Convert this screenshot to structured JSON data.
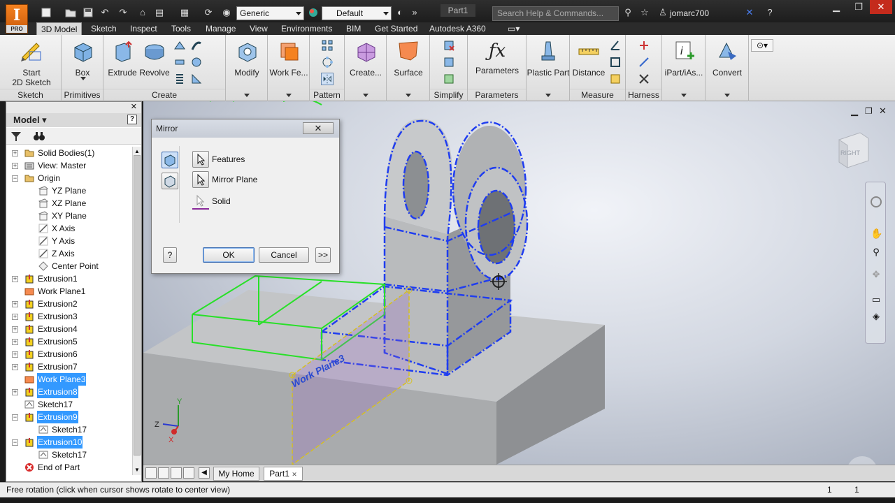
{
  "app": {
    "logo_letter": "I",
    "logo_tag": "PRO",
    "document_title": "Part1",
    "material_combo": "Generic",
    "appearance_combo": "Default",
    "help_search_placeholder": "Search Help & Commands...",
    "user_name": "jomarc700",
    "more_glyph": "»"
  },
  "ribbon_tabs": [
    "3D Model",
    "Sketch",
    "Inspect",
    "Tools",
    "Manage",
    "View",
    "Environments",
    "BIM",
    "Get Started",
    "Autodesk A360"
  ],
  "ribbon": {
    "sketch_panel": {
      "title": "Sketch",
      "start_line1": "Start",
      "start_line2": "2D Sketch"
    },
    "primitives_panel": {
      "title": "Primitives",
      "box": "Box"
    },
    "create_panel": {
      "title": "Create",
      "extrude": "Extrude",
      "revolve": "Revolve"
    },
    "modify_panel": {
      "modify": "Modify"
    },
    "workfeatures_panel": {
      "work_features": "Work Fe..."
    },
    "pattern_panel": {
      "title": "Pattern"
    },
    "create_freeform": {
      "create": "Create..."
    },
    "surface_panel": {
      "surface": "Surface"
    },
    "simplify_panel": {
      "title": "Simplify"
    },
    "parameters_panel": {
      "title": "Parameters",
      "parameters": "Parameters"
    },
    "plastic_panel": {
      "plastic_part": "Plastic Part"
    },
    "measure_panel": {
      "title": "Measure",
      "distance": "Distance"
    },
    "harness_panel": {
      "title": "Harness"
    },
    "ipart_panel": {
      "ipart": "iPart/iAs..."
    },
    "convert_panel": {
      "convert": "Convert"
    }
  },
  "browser": {
    "title": "Model",
    "items": [
      {
        "label": "Solid Bodies(1)",
        "icon": "folder-icon",
        "selected": false
      },
      {
        "label": "View: Master",
        "icon": "view-icon",
        "selected": false
      },
      {
        "label": "Origin",
        "icon": "folder-icon",
        "selected": false
      },
      {
        "label": "YZ Plane",
        "icon": "plane-icon",
        "selected": false
      },
      {
        "label": "XZ Plane",
        "icon": "plane-icon",
        "selected": false
      },
      {
        "label": "XY Plane",
        "icon": "plane-icon",
        "selected": false
      },
      {
        "label": "X Axis",
        "icon": "axis-icon",
        "selected": false
      },
      {
        "label": "Y Axis",
        "icon": "axis-icon",
        "selected": false
      },
      {
        "label": "Z Axis",
        "icon": "axis-icon",
        "selected": false
      },
      {
        "label": "Center Point",
        "icon": "point-icon",
        "selected": false
      },
      {
        "label": "Extrusion1",
        "icon": "extrusion-icon",
        "selected": false
      },
      {
        "label": "Work Plane1",
        "icon": "workplane-icon",
        "selected": false
      },
      {
        "label": "Extrusion2",
        "icon": "extrusion-icon",
        "selected": false
      },
      {
        "label": "Extrusion3",
        "icon": "extrusion-icon",
        "selected": false
      },
      {
        "label": "Extrusion4",
        "icon": "extrusion-icon",
        "selected": false
      },
      {
        "label": "Extrusion5",
        "icon": "extrusion-icon",
        "selected": false
      },
      {
        "label": "Extrusion6",
        "icon": "extrusion-icon",
        "selected": false
      },
      {
        "label": "Extrusion7",
        "icon": "extrusion-icon",
        "selected": false
      },
      {
        "label": "Work Plane3",
        "icon": "workplane-icon",
        "selected": true
      },
      {
        "label": "Extrusion8",
        "icon": "extrusion-icon",
        "selected": true
      },
      {
        "label": "Sketch17",
        "icon": "sketch-icon",
        "selected": false
      },
      {
        "label": "Extrusion9",
        "icon": "extrusion-icon",
        "selected": true
      },
      {
        "label": "Sketch17",
        "icon": "sketch-icon",
        "selected": false
      },
      {
        "label": "Extrusion10",
        "icon": "extrusion-icon",
        "selected": true
      },
      {
        "label": "Sketch17",
        "icon": "sketch-icon",
        "selected": false
      },
      {
        "label": "End of Part",
        "icon": "end-of-part-icon",
        "selected": false
      }
    ]
  },
  "viewport": {
    "viewcube_face": "RIGHT",
    "workplane_label": "Work Plane3",
    "triad": {
      "x": "X",
      "y": "Y",
      "z": "Z"
    }
  },
  "mirror_dialog": {
    "title": "Mirror",
    "close": "✕",
    "features": "Features",
    "mirror_plane": "Mirror Plane",
    "solid": "Solid",
    "ok": "OK",
    "cancel": "Cancel",
    "more": ">>",
    "help": "?"
  },
  "doc_tabs": [
    {
      "label": "My Home",
      "active": false
    },
    {
      "label": "Part1",
      "active": true
    }
  ],
  "status": {
    "message": "Free rotation (click when cursor shows rotate to center view)",
    "count1": "1",
    "count2": "1"
  },
  "colors": {
    "accent_orange": "#f58220",
    "selection_blue": "#1f3df0",
    "preview_green": "#28e028",
    "tree_selection": "#3399ff"
  }
}
